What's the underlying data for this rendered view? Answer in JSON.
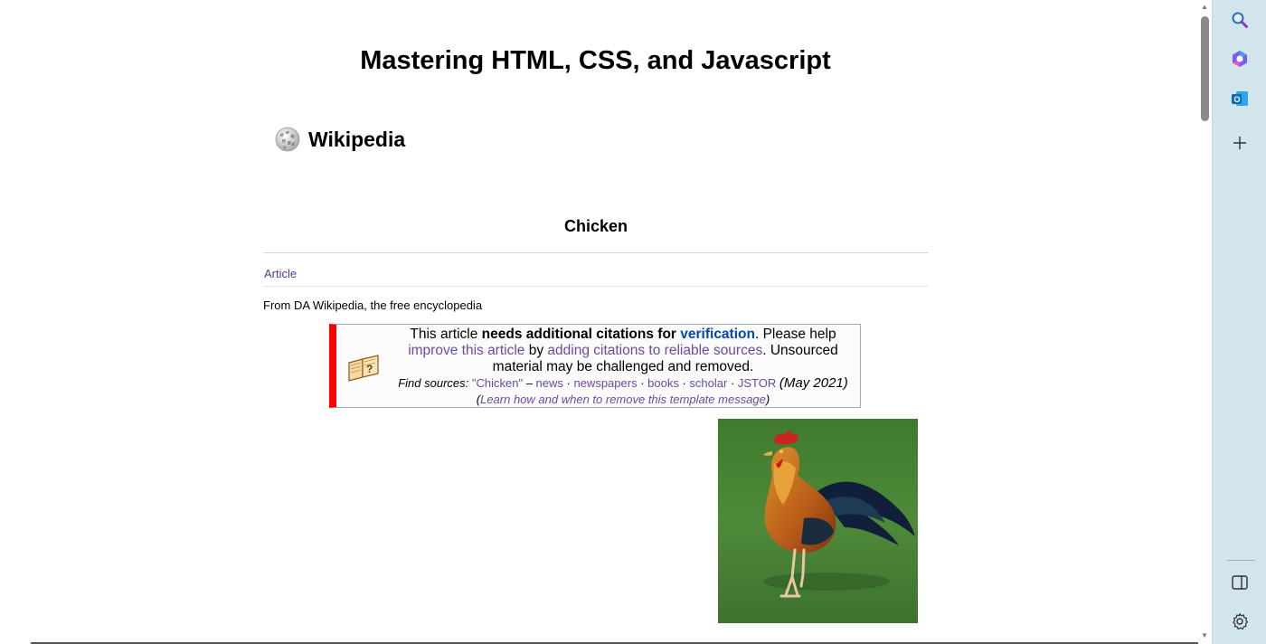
{
  "page": {
    "title": "Mastering HTML, CSS, and Javascript",
    "wiki_name": "Wikipedia",
    "article_title": "Chicken",
    "tab_article": "Article",
    "from_line": "From DA Wikipedia, the free encyclopedia"
  },
  "ambox": {
    "t1": "This article ",
    "t2": "needs additional citations for ",
    "t3": "verification",
    "t4": ". Please help ",
    "t5": "improve this article",
    "t6": " by ",
    "t7": "adding citations to reliable sources",
    "t8": ". Unsourced material may be challenged and removed.",
    "find_sources": "Find sources:",
    "q_chicken": "\"Chicken\"",
    "dash": " – ",
    "news": "news",
    "sep": " · ",
    "newspapers": "newspapers",
    "books": "books",
    "scholar": "scholar",
    "jstor": "JSTOR",
    "date": "(May 2021)",
    "open_paren": "(",
    "learn": "Learn how and when to remove this template message",
    "close_paren": ")"
  },
  "sidebar": {
    "icons": [
      "search-icon",
      "copilot-icon",
      "outlook-icon",
      "add-icon",
      "sidebar-toggle-icon",
      "settings-icon"
    ]
  },
  "colors": {
    "link": "#6b4ba1",
    "link_blue": "#0645ad",
    "ambox_bar": "#ff0000",
    "sidebar_bg": "#d3e5ec"
  }
}
